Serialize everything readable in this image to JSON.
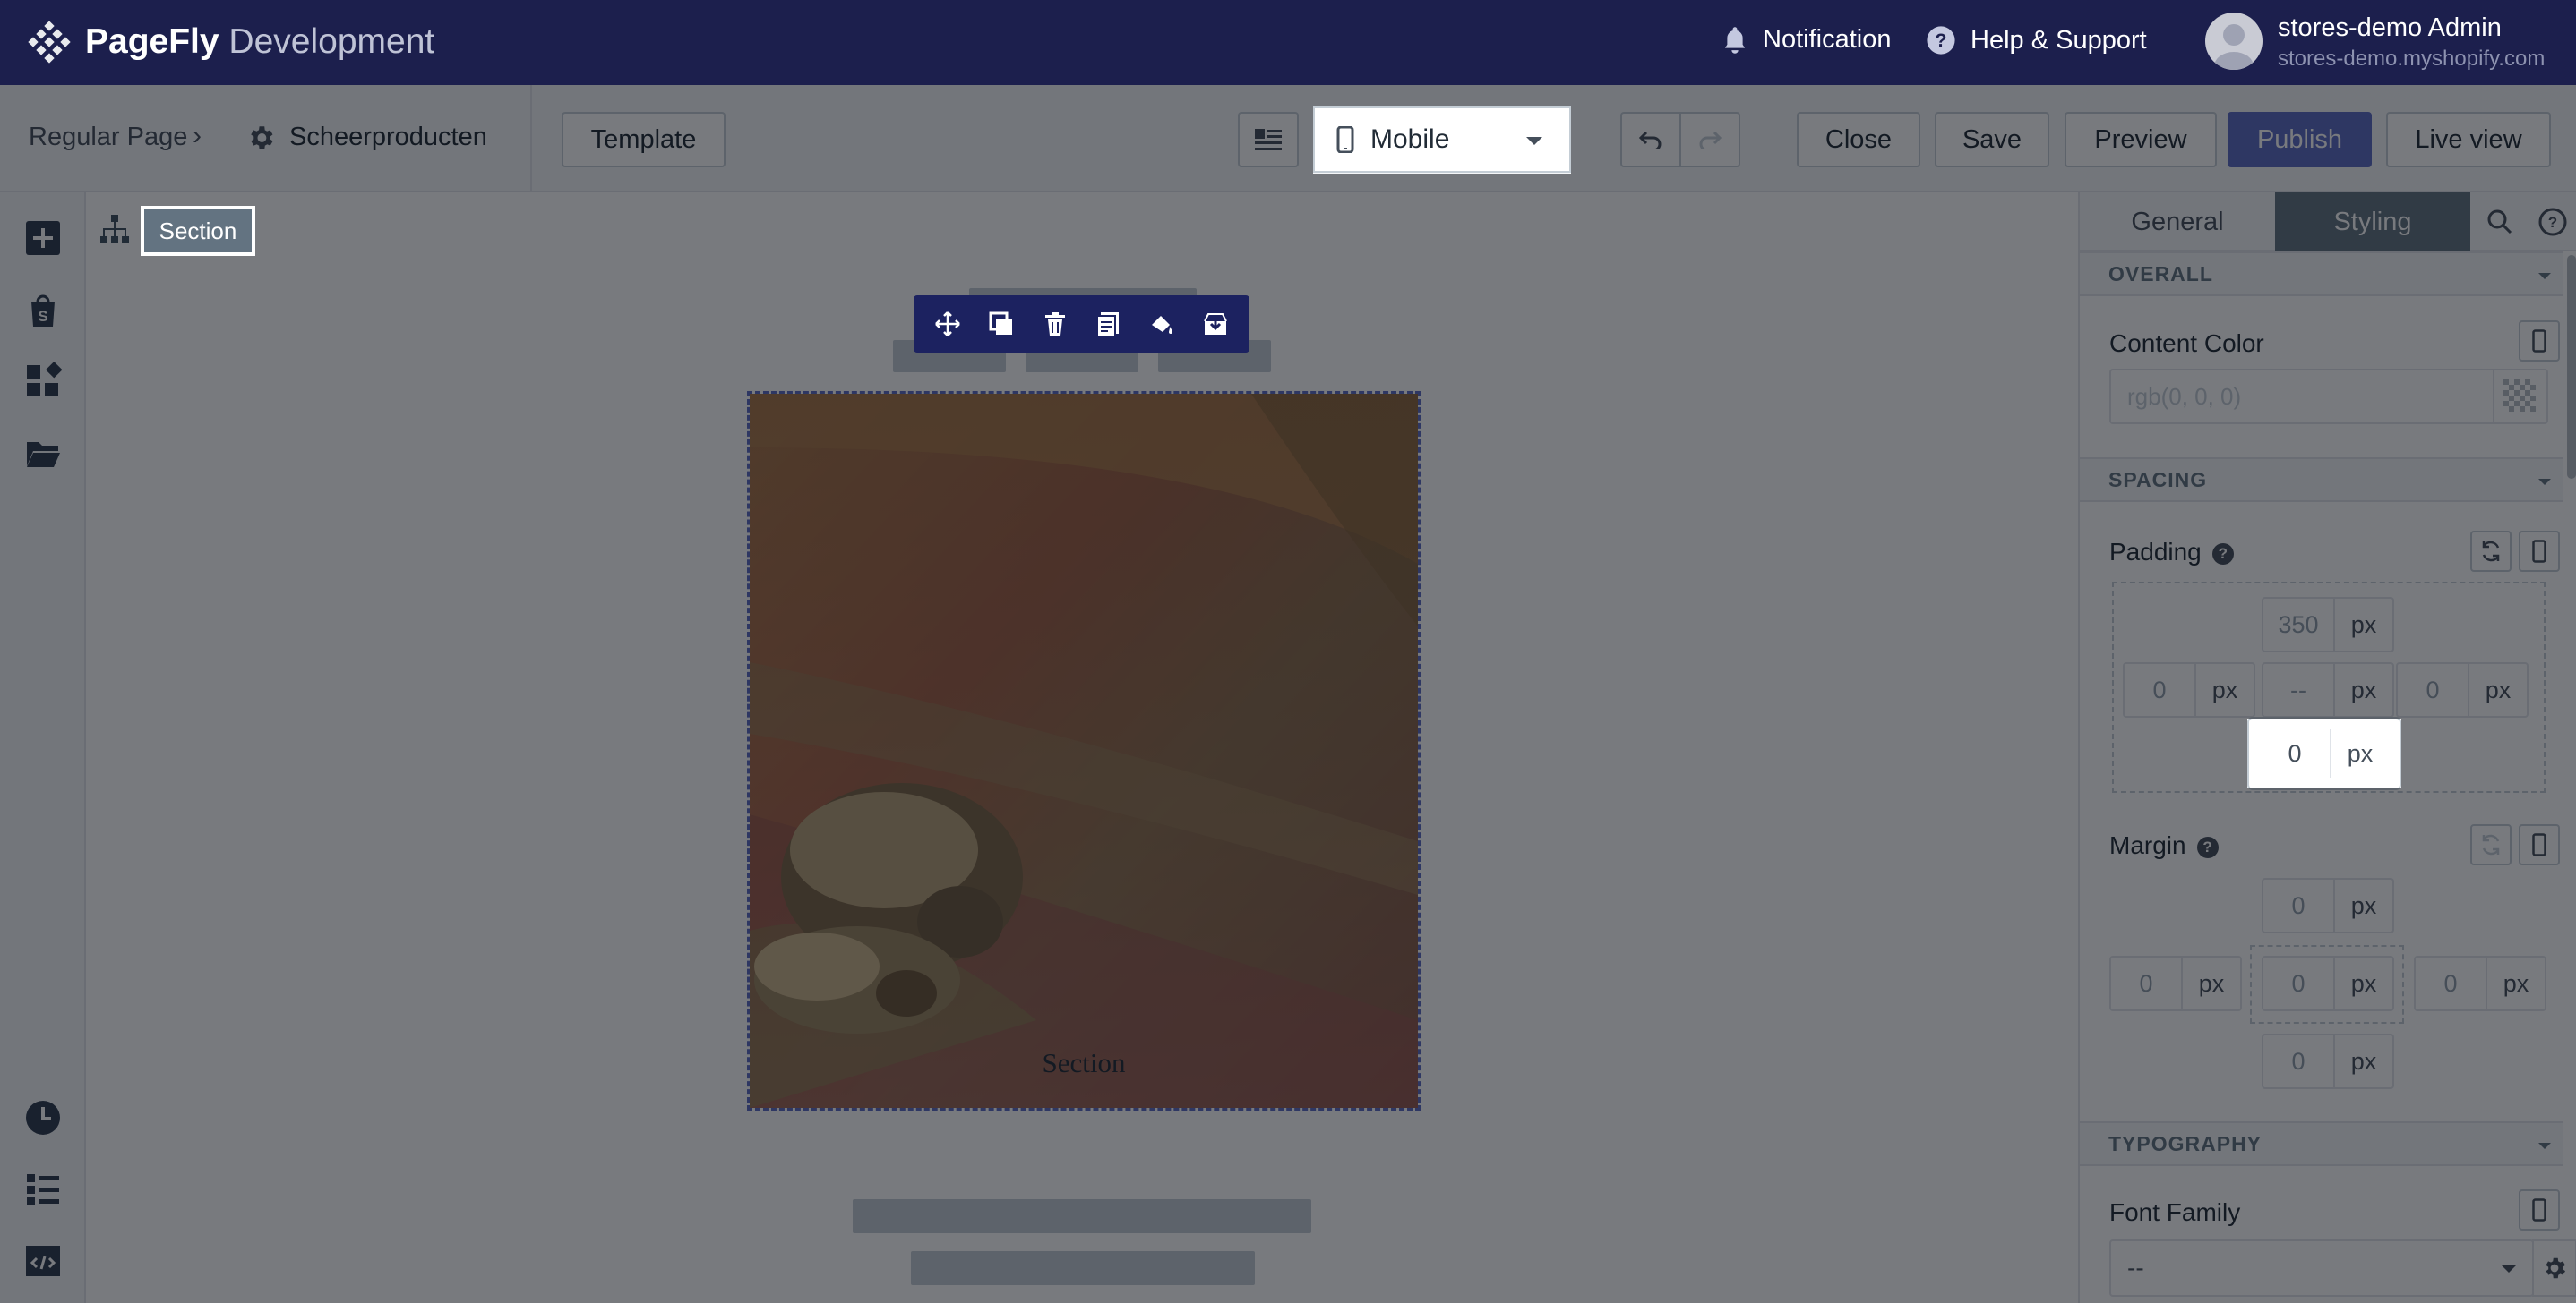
{
  "topbar": {
    "brand_bold": "PageFly",
    "brand_light": "Development",
    "notification_label": "Notification",
    "help_label": "Help & Support",
    "user_name": "stores-demo Admin",
    "user_store": "stores-demo.myshopify.com"
  },
  "toolbar": {
    "breadcrumb_root": "Regular Page",
    "breadcrumb_page": "Scheerproducten",
    "template_label": "Template",
    "device_label": "Mobile",
    "close_label": "Close",
    "save_label": "Save",
    "preview_label": "Preview",
    "publish_label": "Publish",
    "live_view_label": "Live view"
  },
  "canvas": {
    "selected_element": "Section",
    "section_text": "Section"
  },
  "panel": {
    "tabs": [
      {
        "label": "General"
      },
      {
        "label": "Styling"
      }
    ],
    "overall": {
      "header": "OVERALL",
      "content_color_label": "Content Color",
      "content_color_placeholder": "rgb(0, 0, 0)"
    },
    "spacing": {
      "header": "SPACING",
      "padding_label": "Padding",
      "padding": {
        "top": "350",
        "left": "0",
        "center": "--",
        "right": "0",
        "bottom": "0"
      },
      "margin_label": "Margin",
      "margin": {
        "top": "0",
        "left": "0",
        "center": "0",
        "right": "0",
        "bottom": "0"
      },
      "unit": "px"
    },
    "typography": {
      "header": "TYPOGRAPHY",
      "font_family_label": "Font Family",
      "font_family_value": "--"
    }
  },
  "colors": {
    "topbar_bg": "#1c1f4d",
    "accent": "#5c6ac4",
    "active_tab": "#637381",
    "overlay": "rgba(10,12,20,0.55)"
  }
}
